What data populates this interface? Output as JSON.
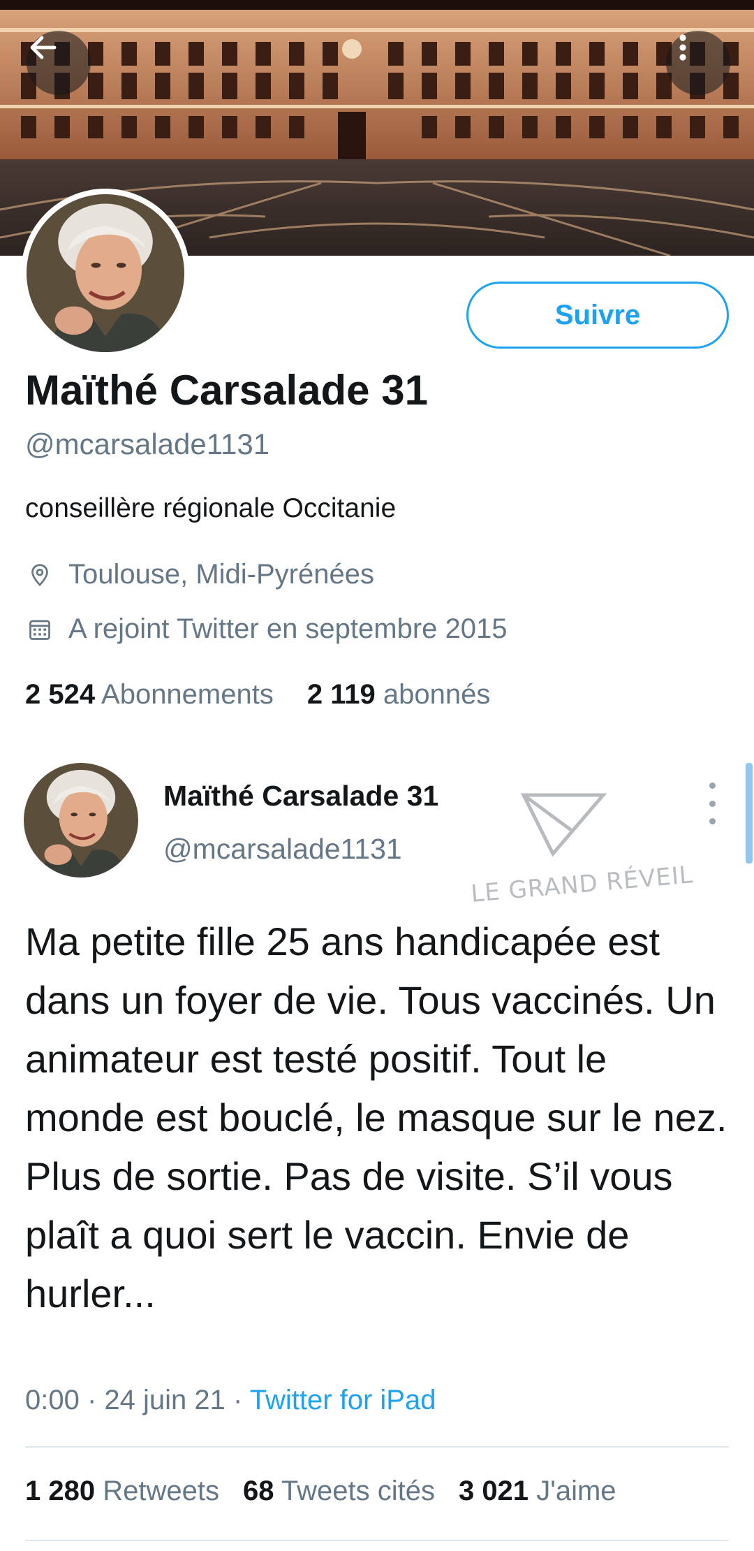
{
  "header": {
    "banner_image": "Capitole de Toulouse at night",
    "back_icon": "arrow-left-icon",
    "more_icon": "more-vertical-icon"
  },
  "profile": {
    "follow_label": "Suivre",
    "name": "Maïthé Carsalade 31",
    "handle": "@mcarsalade1131",
    "bio": "conseillère régionale Occitanie",
    "location": "Toulouse, Midi-Pyrénées",
    "location_icon": "location-pin-icon",
    "joined": "A rejoint Twitter en septembre 2015",
    "joined_icon": "calendar-icon",
    "following_count": "2 524",
    "following_label": "Abonnements",
    "followers_count": "2 119",
    "followers_label": "abonnés"
  },
  "tweet": {
    "author_name": "Maïthé Carsalade 31",
    "author_handle": "@mcarsalade1131",
    "text": "Ma petite fille 25 ans handicapée est dans un foyer de vie. Tous vaccinés. Un animateur est testé positif. Tout le monde est bouclé, le masque sur le nez. Plus de sortie. Pas de visite. S’il vous plaît a quoi sert le vaccin. Envie de hurler...",
    "time": "0:00",
    "sep1": " · ",
    "date": "24 juin 21",
    "sep2": " · ",
    "source": "Twitter for iPad",
    "retweets_count": "1 280",
    "retweets_label": "Retweets",
    "quotes_count": "68",
    "quotes_label": "Tweets cités",
    "likes_count": "3 021",
    "likes_label": "J'aime"
  },
  "watermark": {
    "text": "LE GRAND RÉVEIL"
  },
  "colors": {
    "accent": "#1da1f2",
    "text_primary": "#14171a",
    "text_secondary": "#657786",
    "divider": "#e1e8ed"
  }
}
